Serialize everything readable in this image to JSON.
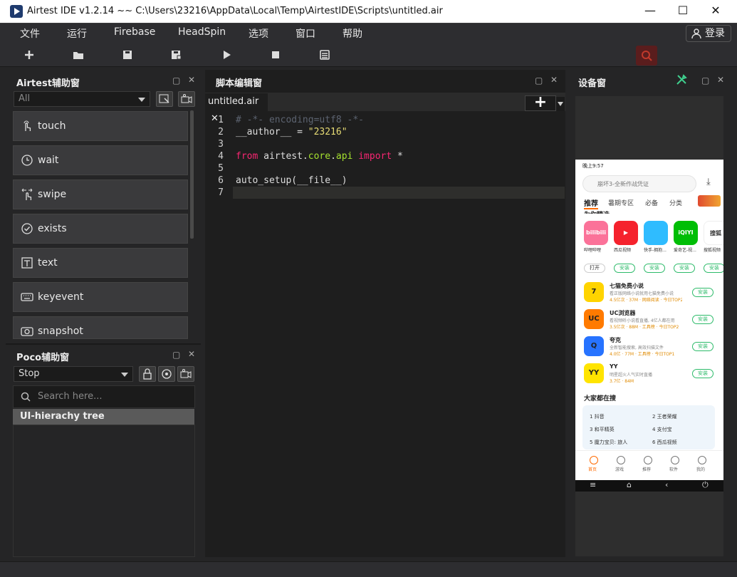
{
  "window": {
    "title": "Airtest IDE v1.2.14 ~~ C:\\Users\\23216\\AppData\\Local\\Temp\\AirtestIDE\\Scripts\\untitled.air",
    "minimize": "—",
    "maximize": "☐",
    "close": "✕"
  },
  "menu": {
    "items": [
      "文件",
      "运行",
      "Firebase",
      "HeadSpin",
      "选项",
      "窗口",
      "帮助"
    ],
    "login": "登录"
  },
  "toolbar": {
    "icons": [
      "new-file-icon",
      "open-folder-icon",
      "save-icon",
      "save-as-icon",
      "run-icon",
      "stop-icon",
      "log-icon",
      "search-icon"
    ]
  },
  "airtest_panel": {
    "title": "Airtest辅助窗",
    "filter_value": "All",
    "actions": [
      {
        "label": "touch",
        "icon": "hand-touch-icon"
      },
      {
        "label": "wait",
        "icon": "clock-icon"
      },
      {
        "label": "swipe",
        "icon": "hand-swipe-icon"
      },
      {
        "label": "exists",
        "icon": "check-circle-icon"
      },
      {
        "label": "text",
        "icon": "text-box-icon"
      },
      {
        "label": "keyevent",
        "icon": "keyboard-icon"
      },
      {
        "label": "snapshot",
        "icon": "camera-icon"
      }
    ]
  },
  "poco_panel": {
    "title": "Poco辅助窗",
    "mode_value": "Stop",
    "search_placeholder": "Search here...",
    "tree_label": "UI-hierachy tree"
  },
  "editor": {
    "title": "脚本编辑窗",
    "tab_label": "untitled.air",
    "add_label": "+",
    "lines": [
      {
        "n": "1",
        "parts": [
          {
            "t": "# -*- encoding=utf8 -*-",
            "c": "com"
          }
        ]
      },
      {
        "n": "2",
        "parts": [
          {
            "t": "__author__ = ",
            "c": "pl"
          },
          {
            "t": "\"23216\"",
            "c": "str"
          }
        ]
      },
      {
        "n": "3",
        "parts": []
      },
      {
        "n": "4",
        "parts": [
          {
            "t": "from",
            "c": "kw"
          },
          {
            "t": " airtest.",
            "c": "pl"
          },
          {
            "t": "core",
            "c": "mod"
          },
          {
            "t": ".",
            "c": "pl"
          },
          {
            "t": "api",
            "c": "mod"
          },
          {
            "t": " ",
            "c": "pl"
          },
          {
            "t": "import",
            "c": "kw"
          },
          {
            "t": " *",
            "c": "pl"
          }
        ]
      },
      {
        "n": "5",
        "parts": []
      },
      {
        "n": "6",
        "parts": [
          {
            "t": "auto_setup(__file__)",
            "c": "pl"
          }
        ]
      },
      {
        "n": "7",
        "parts": []
      }
    ]
  },
  "device_panel": {
    "title": "设备窗",
    "phone": {
      "status_time": "晚上9:57",
      "search_placeholder": "崩坏3-全新作战凭证",
      "tabs": [
        "推荐",
        "暑期专区",
        "必备",
        "分类"
      ],
      "section_top": "为你精选",
      "featured_apps": [
        {
          "name": "哔哩哔哩",
          "button": "打开",
          "color": "#fb7299",
          "text": "bilibili"
        },
        {
          "name": "西瓜视频",
          "button": "安装",
          "color": "#f5222d",
          "text": "▶"
        },
        {
          "name": "快手-拥抱...",
          "button": "安装",
          "color": "#2fbcff",
          "text": ""
        },
        {
          "name": "爱奇艺-视...",
          "button": "安装",
          "color": "#00be06",
          "text": "iQIYI"
        },
        {
          "name": "搜狐视频",
          "button": "安装",
          "color": "#ffffff",
          "text": "搜狐"
        }
      ],
      "list_apps": [
        {
          "name": "七猫免费小说",
          "desc": "看正版网络小说就用七猫免费小说",
          "meta": "4.5亿次 · 37M · 网络阅读 · 今日TOP2",
          "button": "安装",
          "color": "#ffd400",
          "text": "7"
        },
        {
          "name": "UC浏览器",
          "desc": "看视频听小说看直播, 4亿人都在用",
          "meta": "3.5亿次 · 88M · 工具榜 · 今日TOP2",
          "button": "安装",
          "color": "#ff7a00",
          "text": "UC"
        },
        {
          "name": "夸克",
          "desc": "全新智能搜索, 高效扫描文件",
          "meta": "4.0亿 · 77M · 工具榜 · 今日TOP1",
          "button": "安装",
          "color": "#2773ff",
          "text": "Q"
        },
        {
          "name": "YY",
          "desc": "明星超火人气实时直播",
          "meta": "3.7亿 · 84M",
          "button": "安装",
          "color": "#ffe400",
          "text": "YY"
        }
      ],
      "hot_title": "大家都在搜",
      "hot_items": [
        "1 抖音",
        "2 王者荣耀",
        "3 和平精英",
        "4 支付宝",
        "5 魔力宝贝: 旅人",
        "6 西瓜视频"
      ],
      "bottom_tabs": [
        "首页",
        "游戏",
        "推荐",
        "软件",
        "我的"
      ]
    }
  },
  "colors": {
    "accent_red": "#c0392b",
    "install_green": "#2dbb6a",
    "panel_bg": "#252526",
    "editor_bg": "#1e1e1e"
  }
}
